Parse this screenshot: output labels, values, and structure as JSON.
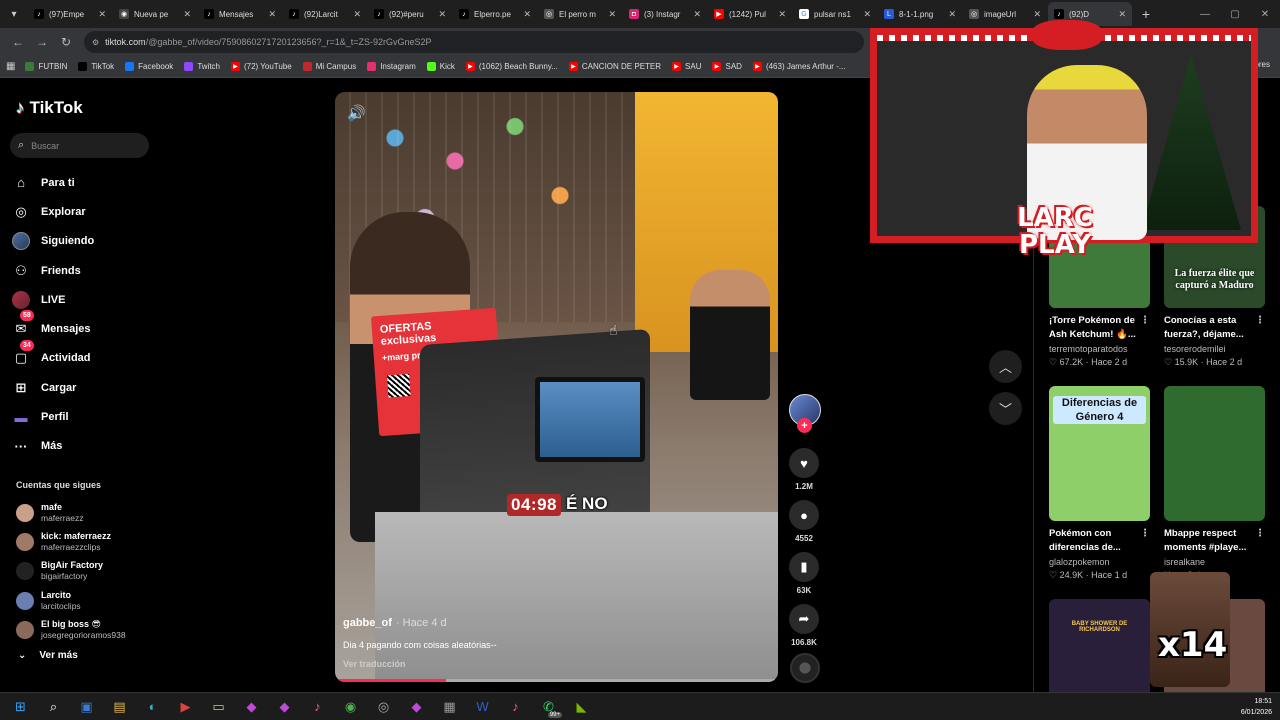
{
  "browser": {
    "tabs": [
      {
        "label": "(97)Empe",
        "favicon": "tiktok-icon",
        "active": false
      },
      {
        "label": "Nueva pe",
        "favicon": "chrome-icon",
        "active": false
      },
      {
        "label": "Mensajes",
        "favicon": "tiktok-icon",
        "active": false
      },
      {
        "label": "(92)Larcit",
        "favicon": "tiktok-icon",
        "active": false
      },
      {
        "label": "(92)#peru",
        "favicon": "tiktok-icon",
        "active": false
      },
      {
        "label": "Elperro.pe",
        "favicon": "tiktok-icon",
        "active": false
      },
      {
        "label": "El perro m",
        "favicon": "globe-icon",
        "active": false
      },
      {
        "label": "(3) Instagr",
        "favicon": "instagram-icon",
        "active": false
      },
      {
        "label": "(1242) Pul",
        "favicon": "youtube-icon",
        "active": false
      },
      {
        "label": "pulsar ns1",
        "favicon": "google-icon",
        "active": false
      },
      {
        "label": "8-1-1.png",
        "favicon": "image-icon",
        "active": false
      },
      {
        "label": "imageUrl",
        "favicon": "globe-icon",
        "active": false
      },
      {
        "label": "(92)D",
        "favicon": "tiktok-icon",
        "active": true
      }
    ],
    "url_host": "tiktok.com",
    "url_path": "/@gabbe_of/video/7590860271720123656?_r=1&_t=ZS-92rGvGneS2P",
    "bookmarks": [
      {
        "label": "FUTBIN",
        "icon": "futbin-icon",
        "color": "#3a7d3a"
      },
      {
        "label": "TikTok",
        "icon": "tiktok-icon",
        "color": "#000000"
      },
      {
        "label": "Facebook",
        "icon": "facebook-icon",
        "color": "#1877f2"
      },
      {
        "label": "Twitch",
        "icon": "twitch-icon",
        "color": "#9146ff"
      },
      {
        "label": "(72) YouTube",
        "icon": "youtube-icon",
        "color": "#ff0000"
      },
      {
        "label": "Mi Campus",
        "icon": "campus-icon",
        "color": "#c0282d"
      },
      {
        "label": "Instagram",
        "icon": "instagram-icon",
        "color": "#e1306c"
      },
      {
        "label": "Kick",
        "icon": "kick-icon",
        "color": "#53fc18"
      },
      {
        "label": "(1062) Beach Bunny...",
        "icon": "youtube-icon",
        "color": "#ff0000"
      },
      {
        "label": "CANCION DE PETER",
        "icon": "youtube-icon",
        "color": "#ff0000"
      },
      {
        "label": "SAU",
        "icon": "youtube-icon",
        "color": "#ff0000"
      },
      {
        "label": "SAD",
        "icon": "youtube-icon",
        "color": "#ff0000"
      },
      {
        "label": "(463) James Arthur -...",
        "icon": "youtube-icon",
        "color": "#ff0000"
      }
    ],
    "bookmarks_tail": "ores"
  },
  "tiktok": {
    "logo_text": "TikTok",
    "search_placeholder": "Buscar",
    "nav": [
      {
        "label": "Para ti",
        "icon": "home-icon"
      },
      {
        "label": "Explorar",
        "icon": "compass-icon"
      },
      {
        "label": "Siguiendo",
        "icon": "following-avatar-icon"
      },
      {
        "label": "Friends",
        "icon": "friends-icon"
      },
      {
        "label": "LIVE",
        "icon": "live-icon"
      },
      {
        "label": "Mensajes",
        "icon": "messages-icon",
        "badge": "58"
      },
      {
        "label": "Actividad",
        "icon": "activity-icon",
        "badge": "34"
      },
      {
        "label": "Cargar",
        "icon": "upload-icon"
      },
      {
        "label": "Perfil",
        "icon": "profile-icon"
      },
      {
        "label": "Más",
        "icon": "more-icon"
      }
    ],
    "following_title": "Cuentas que sigues",
    "following": [
      {
        "name": "mafe",
        "user": "maferraezz",
        "color": "#c9a089"
      },
      {
        "name": "kick: maferraezz",
        "user": "maferraezzclips",
        "color": "#a07a66"
      },
      {
        "name": "BigAir Factory",
        "user": "bigairfactory",
        "color": "#222222"
      },
      {
        "name": "Larcito",
        "user": "larcitoclips",
        "color": "#6a7fb0"
      },
      {
        "name": "El big boss 😎",
        "user": "josegregorioramos938",
        "color": "#8a6a5a"
      }
    ],
    "see_more": "Ver más"
  },
  "video": {
    "caption_time": "04:98",
    "caption_rest": "É NO",
    "offer_text": "OFERTAS exclusivas",
    "offer_brand": "+marg pra você",
    "author": "gabbe_of",
    "posted": "· Hace 4 d",
    "description": "Dia 4 pagando com coisas aleatórias--",
    "translate": "Ver traducción",
    "progress_fraction": 0.25
  },
  "actions": {
    "likes": "1.2M",
    "comments": "4552",
    "saves": "63K",
    "shares": "106.8K"
  },
  "recommendations": [
    {
      "title": "¡Torre Pokémon de Ash Ketchum! 🔥...",
      "user": "terremotoparatodos",
      "likes": "67.2K",
      "ago": "Hace 2 d",
      "thumb_text": "",
      "bg": "#3f7a3a"
    },
    {
      "title": "Conocías a esta fuerza?, déjame...",
      "user": "tesorerodemilei",
      "likes": "15.9K",
      "ago": "Hace 2 d",
      "thumb_text": "La fuerza élite que capturó a Maduro",
      "bg": "#2b4a2a"
    },
    {
      "title": "Pokémon con diferencias de...",
      "user": "glalozpokemon",
      "likes": "24.9K",
      "ago": "Hace 1 d",
      "thumb_text": "Diferencias de Género 4",
      "bg": "#8fcf6a"
    },
    {
      "title": "Mbappe respect moments #playe...",
      "user": "isrealkane",
      "likes": "",
      "ago": "Hace 2 d",
      "thumb_text": "",
      "bg": "#2f6a2f"
    },
    {
      "title": "",
      "user": "",
      "likes": "",
      "ago": "",
      "thumb_text": "BABY SHOWER DE RICHARDSON",
      "bg": "#2a1f3a"
    },
    {
      "title": "",
      "user": "",
      "likes": "",
      "ago": "",
      "thumb_text": "",
      "bg": "#6a4a40"
    }
  ],
  "overlay": {
    "brand_line1": "LARC",
    "brand_line2": "PLAY",
    "emote_text": "x14"
  },
  "taskbar": {
    "apps": [
      "windows-icon",
      "search-icon",
      "store-icon",
      "files-icon",
      "edge-icon",
      "media-icon",
      "folder-icon",
      "app-icon",
      "app-icon",
      "tiktok-icon",
      "chrome-icon",
      "obs-icon",
      "app-icon",
      "calculator-icon",
      "word-icon",
      "tiktok-icon",
      "whatsapp-icon",
      "nvidia-icon"
    ],
    "whatsapp_badge": "99+",
    "time": "18:51",
    "date": "6/01/2026"
  }
}
